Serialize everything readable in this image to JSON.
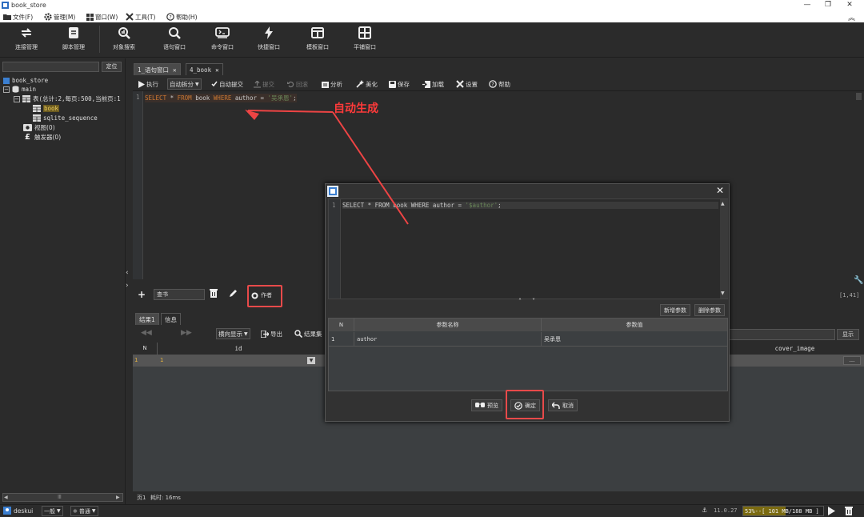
{
  "window": {
    "title": "book_store"
  },
  "menu": [
    {
      "label": "文件(F)",
      "icon": "folder-icon"
    },
    {
      "label": "管理(M)",
      "icon": "gear-icon"
    },
    {
      "label": "窗口(W)",
      "icon": "windows-icon"
    },
    {
      "label": "工具(T)",
      "icon": "tools-icon"
    },
    {
      "label": "帮助(H)",
      "icon": "help-icon"
    }
  ],
  "toolbar": [
    {
      "label": "连接管理",
      "icon": "connection-icon"
    },
    {
      "label": "脚本管理",
      "icon": "script-icon"
    },
    {
      "label": "对象搜索",
      "icon": "object-search-icon"
    },
    {
      "label": "语句窗口",
      "icon": "search-icon"
    },
    {
      "label": "命令窗口",
      "icon": "terminal-icon"
    },
    {
      "label": "快捷窗口",
      "icon": "lightning-icon"
    },
    {
      "label": "模板窗口",
      "icon": "template-icon"
    },
    {
      "label": "平铺窗口",
      "icon": "tile-icon"
    }
  ],
  "left": {
    "locate_label": "定位",
    "tree": {
      "db": "book_store",
      "schema": "main",
      "tables": "表(总计:2,每页:500,当前页:1",
      "table1": "book",
      "table2": "sqlite_sequence",
      "views": "视图(0)",
      "triggers": "触发器(0)"
    }
  },
  "tabs": [
    {
      "label": "1_语句窗口"
    },
    {
      "label": "4_book"
    }
  ],
  "editor_toolbar": {
    "execute": "执行",
    "split": "自动拆分",
    "autocommit": "自动提交",
    "commit": "提交",
    "rollback": "回滚",
    "analyze": "分析",
    "beautify": "美化",
    "save": "保存",
    "load": "加载",
    "settings": "设置",
    "help": "帮助"
  },
  "editor": {
    "line_no": "1",
    "sql_kw1": "SELECT",
    "sql_star": " * ",
    "sql_kw2": "FROM",
    "sql_t": " book ",
    "sql_kw3": "WHERE",
    "sql_c": " author = ",
    "sql_val": "'吴承恩'",
    "sql_end": ";",
    "cursor_pos": "[1,41]"
  },
  "annotation": "自动生成",
  "filter": {
    "value": "查书",
    "author_btn": "作者"
  },
  "results": {
    "tab1": "结果1",
    "tab2": "信息",
    "mode": "横向显示",
    "export": "导出",
    "result_set": "结果集",
    "show": "显示",
    "col_n": "N",
    "col_id": "id",
    "col_cover": "cover_image",
    "row1_n": "1",
    "row1_id": "1",
    "more": "...",
    "page_info": "页1",
    "elapsed": "耗时: 16ms"
  },
  "status": {
    "user": "deskui",
    "mode1": "一般",
    "mode2": "普通",
    "version": "11.0.27",
    "memory": "53%--[ 101 MB/188 MB ]"
  },
  "dialog": {
    "line_no": "1",
    "sql_kw1": "SELECT",
    "sql_star": " * ",
    "sql_kw2": "FROM",
    "sql_t": " book ",
    "sql_kw3": "WHERE",
    "sql_c": " author = ",
    "sql_val": "'$author'",
    "sql_end": ";",
    "add_param": "新增参数",
    "del_param": "删除参数",
    "col_n": "N",
    "col_name": "参数名称",
    "col_value": "参数值",
    "row1_n": "1",
    "row1_name": "author",
    "row1_value": "吴承恩",
    "preview": "预览",
    "ok": "确定",
    "cancel": "取消"
  }
}
